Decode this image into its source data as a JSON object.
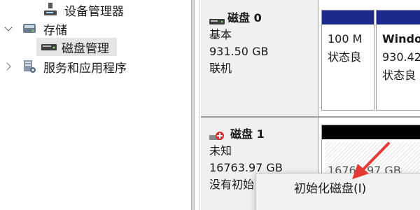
{
  "tree": {
    "device_manager": "设备管理器",
    "storage": "存储",
    "disk_management": "磁盘管理",
    "services_apps": "服务和应用程序"
  },
  "disks": [
    {
      "name": "磁盘 0",
      "type": "基本",
      "size": "931.50 GB",
      "status": "联机",
      "partitions": [
        {
          "size": "100 M",
          "status": "状态良"
        },
        {
          "label": "Windo",
          "size": "930.42",
          "status": "状态良"
        }
      ]
    },
    {
      "name": "磁盘 1",
      "type": "未知",
      "size": "16763.97 GB",
      "status": "没有初始",
      "partitions": [
        {
          "size": "16763.97 GB"
        }
      ]
    }
  ],
  "context_menu": {
    "items": [
      "初始化磁盘(I)"
    ]
  },
  "colors": {
    "primary_partition_bar": "#1c2a8c",
    "unallocated_bar": "#000000",
    "annotation_arrow": "#e53935",
    "disk_error_badge": "#d32f2f"
  }
}
